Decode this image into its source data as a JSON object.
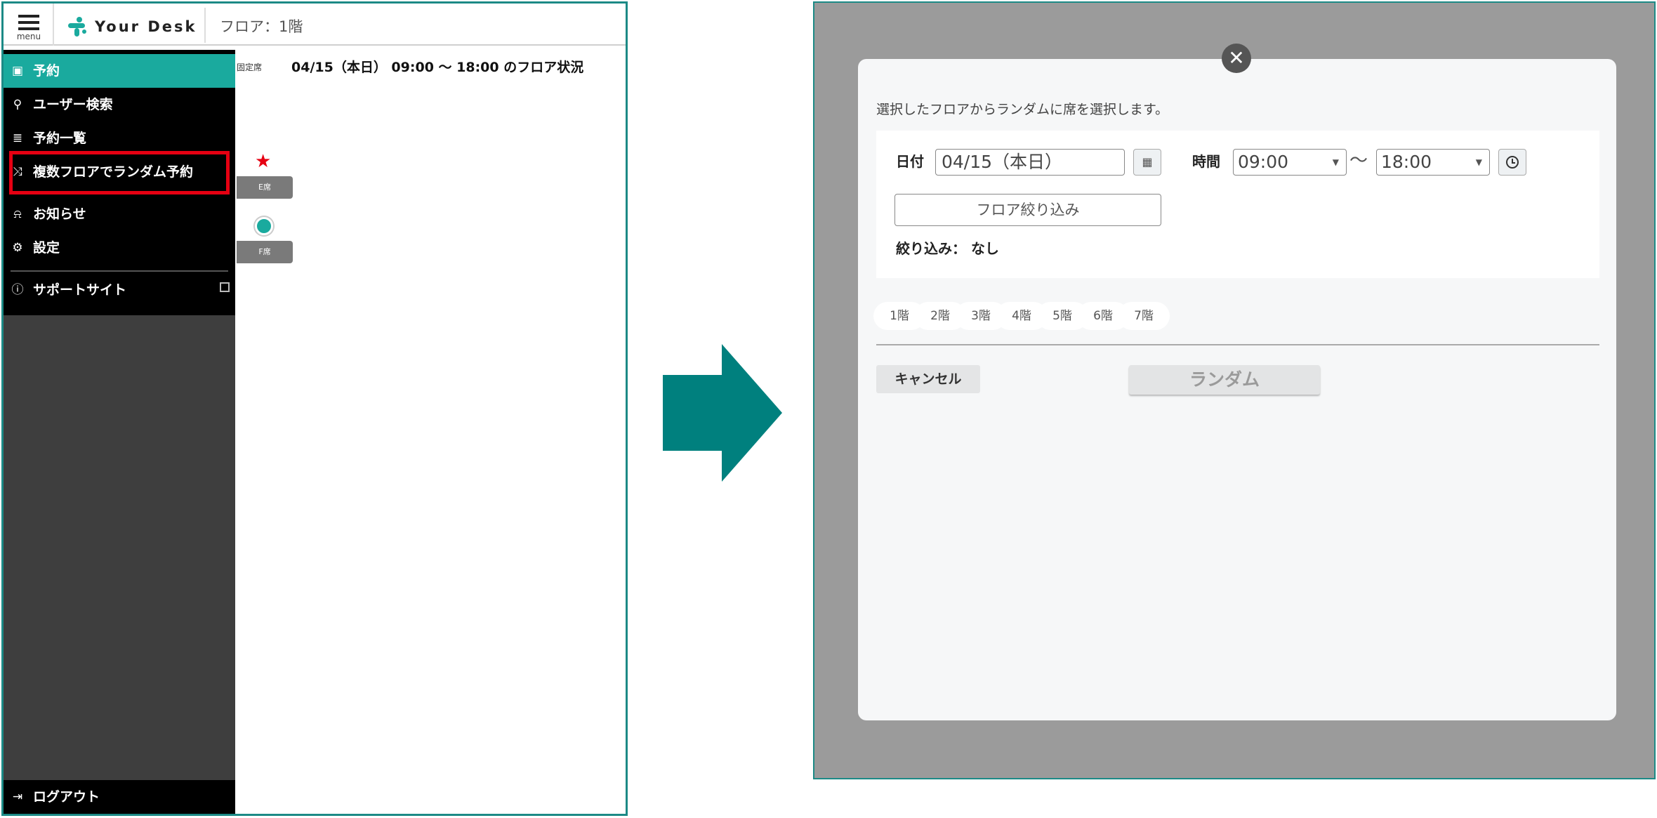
{
  "left_screen": {
    "header": {
      "menu_label": "menu",
      "logo_text": "Your Desk",
      "floor": "フロア：1階"
    },
    "sidebar": {
      "items": [
        {
          "label": "予約",
          "icon": "calendar-icon"
        },
        {
          "label": "ユーザー検索",
          "icon": "search-icon"
        },
        {
          "label": "予約一覧",
          "icon": "list-icon"
        },
        {
          "label": "複数フロアでランダム予約",
          "icon": "shuffle-icon"
        },
        {
          "label": "お知らせ",
          "icon": "bell-icon"
        },
        {
          "label": "設定",
          "icon": "gear-icon"
        },
        {
          "label": "サポートサイト",
          "icon": "help-circle-icon"
        }
      ],
      "logout_label": "ログアウト"
    },
    "main": {
      "fixed_seat_note": "固定席",
      "status_title": "04/15（本日） 09:00 ～ 18:00 のフロア状況",
      "seats": [
        {
          "label": "E席",
          "marker": "star"
        },
        {
          "label": "F席",
          "marker": "circle"
        }
      ]
    }
  },
  "right_screen": {
    "dialog": {
      "description": "選択したフロアからランダムに席を選択します。",
      "date_label": "日付",
      "date_value": "04/15（本日）",
      "time_label": "時間",
      "time_start": "09:00",
      "time_end": "18:00",
      "time_separator": "～",
      "filter_button": "フロア絞り込み",
      "filter_state": "絞り込み： なし",
      "floors": [
        "1階",
        "2階",
        "3階",
        "4階",
        "5階",
        "6階",
        "7階"
      ],
      "cancel_button": "キャンセル",
      "random_button": "ランダム"
    }
  },
  "colors": {
    "accent": "#1aaa9e",
    "frame": "#1c8a86",
    "arrow": "#00807e",
    "highlight": "#e60012",
    "overlay": "#9b9b9b"
  }
}
